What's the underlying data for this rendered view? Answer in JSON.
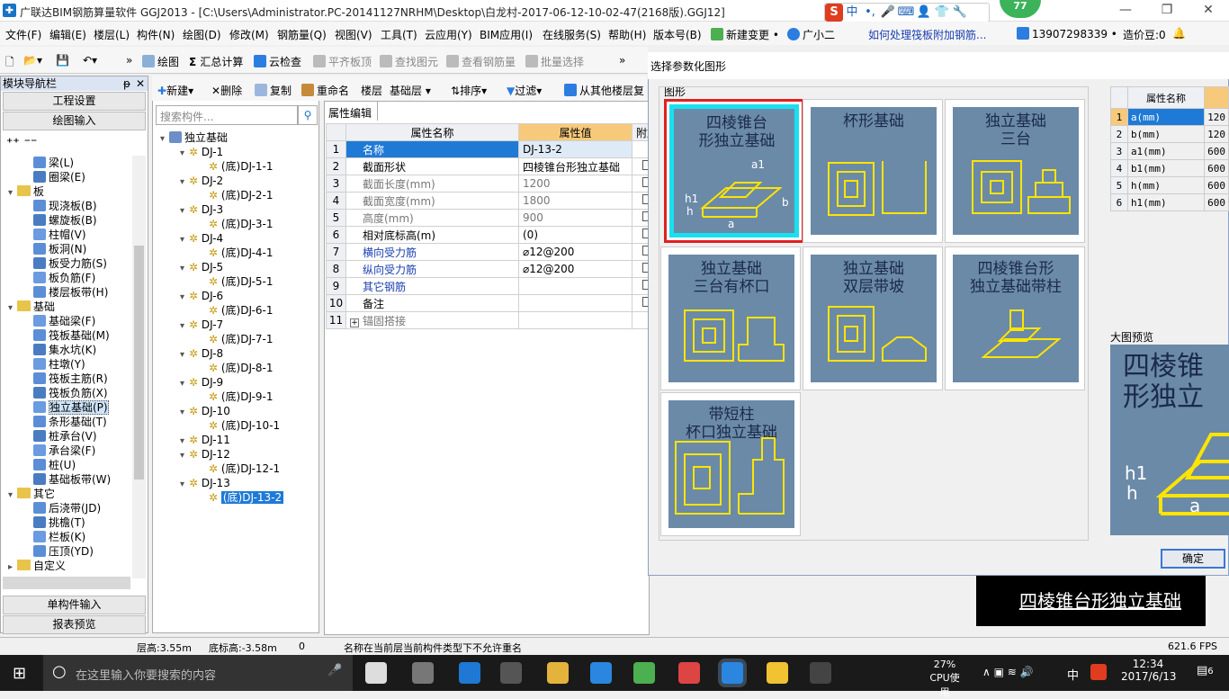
{
  "title_bar": {
    "text": "广联达BIM钢筋算量软件 GGJ2013 - [C:\\Users\\Administrator.PC-20141127NRHM\\Desktop\\白龙村-2017-06-12-10-02-47(2168版).GGJ12]",
    "badge": "77",
    "ime_icon": "S",
    "ime_lang": "中"
  },
  "menu": [
    "文件(F)",
    "编辑(E)",
    "楼层(L)",
    "构件(N)",
    "绘图(D)",
    "修改(M)",
    "钢筋量(Q)",
    "视图(V)",
    "工具(T)",
    "云应用(Y)",
    "BIM应用(I)",
    "在线服务(S)",
    "帮助(H)",
    "版本号(B)",
    "新建变更 •",
    "广小二",
    "如何处理筏板附加钢筋...",
    "13907298339 •",
    "造价豆:0"
  ],
  "toolbar1": {
    "draw": "绘图",
    "sum": "汇总计算",
    "cloud_check": "云检查",
    "flush_slab": "平齐板顶",
    "find": "查找图元",
    "view_rebar": "查看钢筋量",
    "batch_select": "批量选择"
  },
  "nav": {
    "header": "模块导航栏",
    "btn_settings": "工程设置",
    "btn_draw": "绘图输入",
    "btn_single": "单构件输入",
    "btn_report": "报表预览",
    "items": [
      {
        "label": "梁(L)",
        "type": "leaf"
      },
      {
        "label": "圈梁(E)",
        "type": "leaf"
      },
      {
        "label": "板",
        "type": "folder"
      },
      {
        "label": "现浇板(B)",
        "type": "leaf"
      },
      {
        "label": "螺旋板(B)",
        "type": "leaf"
      },
      {
        "label": "柱帽(V)",
        "type": "leaf"
      },
      {
        "label": "板洞(N)",
        "type": "leaf"
      },
      {
        "label": "板受力筋(S)",
        "type": "leaf"
      },
      {
        "label": "板负筋(F)",
        "type": "leaf"
      },
      {
        "label": "楼层板带(H)",
        "type": "leaf"
      },
      {
        "label": "基础",
        "type": "folder"
      },
      {
        "label": "基础梁(F)",
        "type": "leaf"
      },
      {
        "label": "筏板基础(M)",
        "type": "leaf"
      },
      {
        "label": "集水坑(K)",
        "type": "leaf"
      },
      {
        "label": "柱墩(Y)",
        "type": "leaf"
      },
      {
        "label": "筏板主筋(R)",
        "type": "leaf"
      },
      {
        "label": "筏板负筋(X)",
        "type": "leaf"
      },
      {
        "label": "独立基础(P)",
        "type": "leaf"
      },
      {
        "label": "条形基础(T)",
        "type": "leaf"
      },
      {
        "label": "桩承台(V)",
        "type": "leaf"
      },
      {
        "label": "承台梁(F)",
        "type": "leaf"
      },
      {
        "label": "桩(U)",
        "type": "leaf"
      },
      {
        "label": "基础板带(W)",
        "type": "leaf"
      },
      {
        "label": "其它",
        "type": "folder"
      },
      {
        "label": "后浇带(JD)",
        "type": "leaf"
      },
      {
        "label": "挑檐(T)",
        "type": "leaf"
      },
      {
        "label": "栏板(K)",
        "type": "leaf"
      },
      {
        "label": "压顶(YD)",
        "type": "leaf"
      },
      {
        "label": "自定义",
        "type": "folder"
      }
    ]
  },
  "toolbar2": {
    "new": "新建",
    "delete": "删除",
    "copy": "复制",
    "rename": "重命名",
    "floor_label": "楼层",
    "floor_value": "基础层",
    "sort": "排序",
    "filter": "过滤",
    "copy_from": "从其他楼层复"
  },
  "comp_tree": {
    "search_placeholder": "搜索构件...",
    "root": "独立基础",
    "items": [
      "DJ-1",
      "(底)DJ-1-1",
      "DJ-2",
      "(底)DJ-2-1",
      "DJ-3",
      "(底)DJ-3-1",
      "DJ-4",
      "(底)DJ-4-1",
      "DJ-5",
      "(底)DJ-5-1",
      "DJ-6",
      "(底)DJ-6-1",
      "DJ-7",
      "(底)DJ-7-1",
      "DJ-8",
      "(底)DJ-8-1",
      "DJ-9",
      "(底)DJ-9-1",
      "DJ-10",
      "(底)DJ-10-1",
      "DJ-11",
      "DJ-12",
      "(底)DJ-12-1",
      "DJ-13",
      "(底)DJ-13-2"
    ]
  },
  "prop_tab": "属性编辑",
  "prop_table": {
    "headers": [
      "属性名称",
      "属性值",
      "附加"
    ],
    "rows": [
      {
        "n": "1",
        "name": "名称",
        "value": "DJ-13-2"
      },
      {
        "n": "2",
        "name": "截面形状",
        "value": "四棱锥台形独立基础"
      },
      {
        "n": "3",
        "name": "截面长度(mm)",
        "value": "1200"
      },
      {
        "n": "4",
        "name": "截面宽度(mm)",
        "value": "1800"
      },
      {
        "n": "5",
        "name": "高度(mm)",
        "value": "900"
      },
      {
        "n": "6",
        "name": "相对底标高(m)",
        "value": "(0)"
      },
      {
        "n": "7",
        "name": "横向受力筋",
        "value": "⌀12@200"
      },
      {
        "n": "8",
        "name": "纵向受力筋",
        "value": "⌀12@200"
      },
      {
        "n": "9",
        "name": "其它钢筋",
        "value": ""
      },
      {
        "n": "10",
        "name": "备注",
        "value": ""
      },
      {
        "n": "11",
        "name": "锚固搭接",
        "value": ""
      }
    ]
  },
  "dialog": {
    "title": "选择参数化图形",
    "group_label": "图形",
    "preview_label": "大图预览",
    "preview_text": "四棱锥\n形独立",
    "ok": "确定",
    "shapes": [
      "四棱锥台\n形独立基础",
      "杯形基础",
      "独立基础\n三台",
      "独立基础\n三台有杯口",
      "独立基础\n双层带坡",
      "四棱锥台形\n独立基础带柱",
      "带短柱\n杯口独立基础"
    ],
    "param_header": "属性名称",
    "params": [
      {
        "n": "1",
        "name": "a(mm)",
        "value": "120"
      },
      {
        "n": "2",
        "name": "b(mm)",
        "value": "120"
      },
      {
        "n": "3",
        "name": "a1(mm)",
        "value": "600"
      },
      {
        "n": "4",
        "name": "b1(mm)",
        "value": "600"
      },
      {
        "n": "5",
        "name": "h(mm)",
        "value": "600"
      },
      {
        "n": "6",
        "name": "h1(mm)",
        "value": "600"
      }
    ]
  },
  "black_panel_text": "四棱锥台形独立基础",
  "status": {
    "floor_height": "层高:3.55m",
    "bottom_elev": "底标高:-3.58m",
    "zero": "0",
    "message": "名称在当前层当前构件类型下不允许重名",
    "fps": "621.6 FPS"
  },
  "taskbar": {
    "search": "在这里输入你要搜索的内容",
    "cpu_pct": "27%",
    "cpu_label": "CPU使用",
    "lang": "中",
    "time": "12:34",
    "date": "2017/6/13",
    "notif": "6"
  }
}
